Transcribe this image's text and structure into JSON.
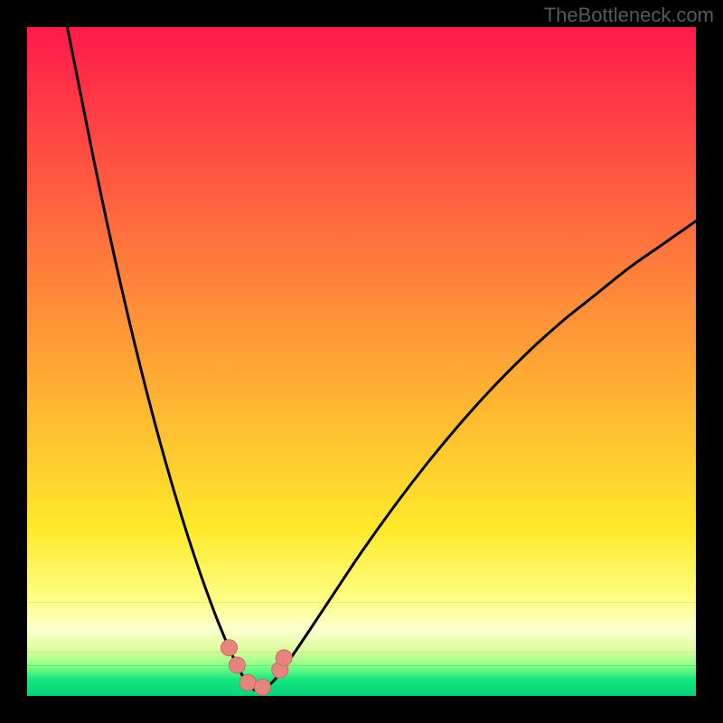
{
  "watermark": "TheBottleneck.com",
  "colors": {
    "background": "#000000",
    "curve": "#000000",
    "marker_fill": "#e6857e",
    "marker_stroke": "#cf6963"
  },
  "chart_data": {
    "type": "line",
    "title": "",
    "xlabel": "",
    "ylabel": "",
    "xlim": [
      0,
      100
    ],
    "ylim": [
      0,
      100
    ],
    "gradient_bands": [
      {
        "y0": 100,
        "y1": 25,
        "color_top": "#ff1a4b",
        "color_bottom": "#ffe92a"
      },
      {
        "y0": 25,
        "y1": 14,
        "color_top": "#ffe92a",
        "color_bottom": "#fdff89"
      },
      {
        "y0": 14,
        "y1": 10,
        "color_top": "#fdff89",
        "color_bottom": "#fdffce"
      },
      {
        "y0": 10,
        "y1": 6.5,
        "color_top": "#fdffce",
        "color_bottom": "#d7ff9a"
      },
      {
        "y0": 6.5,
        "y1": 4.5,
        "color_top": "#d7ff9a",
        "color_bottom": "#86ff86"
      },
      {
        "y0": 4.5,
        "y1": 2.5,
        "color_top": "#86ff86",
        "color_bottom": "#17e77f"
      },
      {
        "y0": 2.5,
        "y1": 0,
        "color_top": "#17e77f",
        "color_bottom": "#05d37a"
      }
    ],
    "series": [
      {
        "name": "bottleneck-curve",
        "x": [
          6,
          8,
          10,
          12,
          14,
          16,
          18,
          20,
          22,
          24,
          26,
          28,
          29,
          30,
          31,
          32,
          33,
          34,
          35,
          37,
          40,
          45,
          50,
          55,
          60,
          65,
          70,
          75,
          80,
          85,
          90,
          95,
          100
        ],
        "y": [
          100,
          90,
          80,
          70.5,
          61.5,
          53,
          45,
          37.5,
          30.5,
          24,
          18,
          12.5,
          10,
          7.6,
          5.4,
          3.4,
          1.8,
          0.9,
          0.9,
          2.4,
          6.5,
          14,
          21.5,
          28.5,
          35,
          41,
          46.5,
          51.5,
          56,
          60,
          64,
          67.5,
          71
        ]
      }
    ],
    "markers": [
      {
        "x": 30.2,
        "y": 7.2
      },
      {
        "x": 31.4,
        "y": 4.6
      },
      {
        "x": 33.0,
        "y": 2.0
      },
      {
        "x": 35.2,
        "y": 1.3
      },
      {
        "x": 37.8,
        "y": 3.9
      },
      {
        "x": 38.4,
        "y": 5.7
      }
    ],
    "marker_radius_px": 9
  }
}
